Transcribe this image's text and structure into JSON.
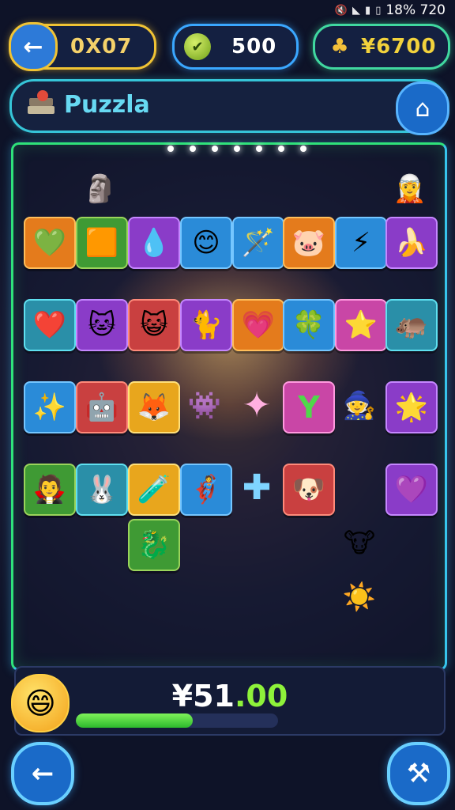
{
  "status": {
    "icons": [
      "mute-icon",
      "wifi-icon",
      "signal-icon",
      "battery-icon"
    ],
    "text": "18% 720"
  },
  "top": {
    "level_value": "0X07",
    "coins_value": "500",
    "gems_value": "¥6700"
  },
  "title": {
    "text": "Puzzla"
  },
  "bottom": {
    "score_main": "¥51",
    "score_decimal": ".00",
    "progress": 0.58
  },
  "board": {
    "tiles": [
      {
        "name": "tile-stone-golem",
        "glyph": "🗿",
        "color": "none",
        "row": 0,
        "col": 1
      },
      {
        "name": "tile-elf-character",
        "glyph": "🧝",
        "color": "none",
        "row": 0,
        "col": 7
      },
      {
        "name": "tile-heart",
        "glyph": "💚",
        "color": "orange",
        "row": 1,
        "col": 0
      },
      {
        "name": "tile-block",
        "glyph": "🟧",
        "color": "green",
        "row": 1,
        "col": 1
      },
      {
        "name": "tile-drop",
        "glyph": "💧",
        "color": "purple",
        "row": 1,
        "col": 2
      },
      {
        "name": "tile-smiley",
        "glyph": "😊",
        "color": "blue",
        "row": 1,
        "col": 3
      },
      {
        "name": "tile-wand",
        "glyph": "🪄",
        "color": "blue",
        "row": 1,
        "col": 4
      },
      {
        "name": "tile-pig",
        "glyph": "🐷",
        "color": "orange",
        "row": 1,
        "col": 5
      },
      {
        "name": "tile-lightning",
        "glyph": "⚡",
        "color": "blue",
        "row": 1,
        "col": 6
      },
      {
        "name": "tile-banana",
        "glyph": "🍌",
        "color": "purple",
        "row": 1,
        "col": 7
      },
      {
        "name": "tile-red-heart",
        "glyph": "❤️",
        "color": "teal",
        "row": 2,
        "col": 0
      },
      {
        "name": "tile-blue-cat",
        "glyph": "🐱",
        "color": "purple",
        "row": 2,
        "col": 1
      },
      {
        "name": "tile-yellow-cat",
        "glyph": "😺",
        "color": "red",
        "row": 2,
        "col": 2
      },
      {
        "name": "tile-gray-cat",
        "glyph": "🐈",
        "color": "purple",
        "row": 2,
        "col": 3
      },
      {
        "name": "tile-pink-heart",
        "glyph": "💗",
        "color": "orange",
        "row": 2,
        "col": 4
      },
      {
        "name": "tile-clover",
        "glyph": "🍀",
        "color": "blue",
        "row": 2,
        "col": 5
      },
      {
        "name": "tile-orange-star",
        "glyph": "⭐",
        "color": "pink",
        "row": 2,
        "col": 6
      },
      {
        "name": "tile-purple-hippo",
        "glyph": "🦛",
        "color": "teal",
        "row": 2,
        "col": 7
      },
      {
        "name": "tile-blue-star",
        "glyph": "✨",
        "color": "blue",
        "row": 3,
        "col": 0
      },
      {
        "name": "tile-green-robot",
        "glyph": "🤖",
        "color": "red",
        "row": 3,
        "col": 1
      },
      {
        "name": "tile-fox",
        "glyph": "🦊",
        "color": "yellow",
        "row": 3,
        "col": 2
      },
      {
        "name": "tile-monster",
        "glyph": "👾",
        "color": "none",
        "row": 3,
        "col": 3
      },
      {
        "name": "tile-sparkle",
        "glyph": "✦",
        "color": "none",
        "row": 3,
        "col": 4
      },
      {
        "name": "tile-letter-y",
        "glyph": "Y",
        "color": "pink",
        "row": 3,
        "col": 5
      },
      {
        "name": "tile-wizard",
        "glyph": "🧙",
        "color": "none",
        "row": 3,
        "col": 6
      },
      {
        "name": "tile-gold-star",
        "glyph": "🌟",
        "color": "purple",
        "row": 3,
        "col": 7
      },
      {
        "name": "tile-witch",
        "glyph": "🧛",
        "color": "green",
        "row": 4,
        "col": 0
      },
      {
        "name": "tile-pink-bunny",
        "glyph": "🐰",
        "color": "teal",
        "row": 4,
        "col": 1
      },
      {
        "name": "tile-blue-bottle",
        "glyph": "🧪",
        "color": "yellow",
        "row": 4,
        "col": 2
      },
      {
        "name": "tile-hero",
        "glyph": "🦸",
        "color": "blue",
        "row": 4,
        "col": 3
      },
      {
        "name": "tile-blue-cross",
        "glyph": "✚",
        "color": "none",
        "row": 4,
        "col": 4
      },
      {
        "name": "tile-dog",
        "glyph": "🐶",
        "color": "red",
        "row": 4,
        "col": 5
      },
      {
        "name": "tile-gem-piece",
        "glyph": "💜",
        "color": "purple",
        "row": 4,
        "col": 7
      },
      {
        "name": "tile-dragon",
        "glyph": "🐉",
        "color": "green",
        "row": 5,
        "col": 2
      },
      {
        "name": "tile-bull",
        "glyph": "🐮",
        "color": "none",
        "row": 5,
        "col": 6
      },
      {
        "name": "tile-sun",
        "glyph": "☀️",
        "color": "none",
        "row": 6,
        "col": 6
      }
    ]
  }
}
